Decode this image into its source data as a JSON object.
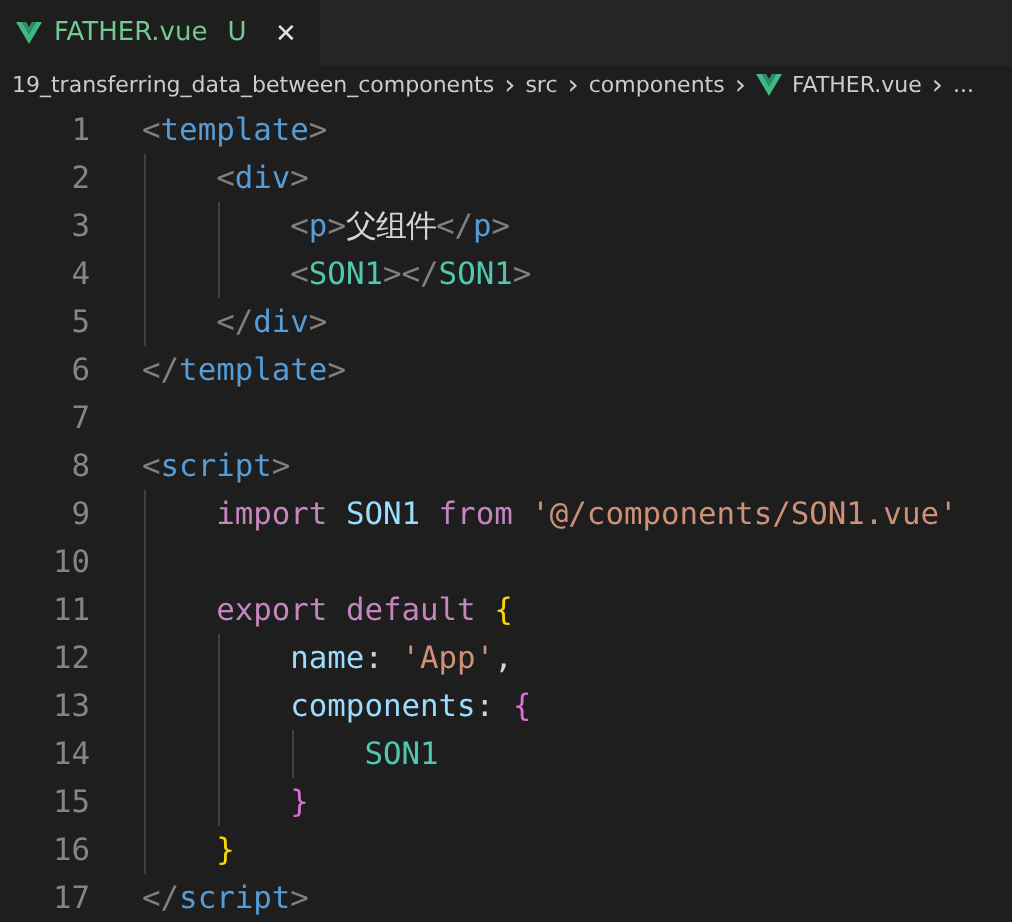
{
  "tabs": [
    {
      "label": "FATHER.vue",
      "status": "U",
      "close": "✕",
      "selected": true
    }
  ],
  "breadcrumb": [
    {
      "label": "19_transferring_data_between_components",
      "kind": "folder"
    },
    {
      "label": "src",
      "kind": "folder"
    },
    {
      "label": "components",
      "kind": "folder"
    },
    {
      "label": "FATHER.vue",
      "kind": "file"
    },
    {
      "label": "...",
      "kind": "more"
    }
  ],
  "separator": "›",
  "lines": [
    {
      "number": "1",
      "tokens": [
        {
          "text": "<",
          "color": "#808080"
        },
        {
          "text": "template",
          "color": "#569cd6"
        },
        {
          "text": ">",
          "color": "#808080"
        }
      ],
      "children": [
        {
          "number": "2",
          "tokens": [
            {
              "text": "<",
              "color": "#808080"
            },
            {
              "text": "div",
              "color": "#569cd6"
            },
            {
              "text": ">",
              "color": "#808080"
            }
          ],
          "children": [
            {
              "number": "3",
              "tokens": [
                {
                  "text": "<",
                  "color": "#808080"
                },
                {
                  "text": "p",
                  "color": "#569cd6"
                },
                {
                  "text": ">",
                  "color": "#808080"
                },
                {
                  "text": "父组件",
                  "color": "#d4d4d4"
                },
                {
                  "text": "</",
                  "color": "#808080"
                },
                {
                  "text": "p",
                  "color": "#569cd6"
                },
                {
                  "text": ">",
                  "color": "#808080"
                }
              ]
            },
            {
              "number": "4",
              "tokens": [
                {
                  "text": "<",
                  "color": "#808080"
                },
                {
                  "text": "SON1",
                  "color": "#4ec9b0"
                },
                {
                  "text": "></",
                  "color": "#808080"
                },
                {
                  "text": "SON1",
                  "color": "#4ec9b0"
                },
                {
                  "text": ">",
                  "color": "#808080"
                }
              ]
            }
          ]
        },
        {
          "number": "5",
          "tokens": [
            {
              "text": "</",
              "color": "#808080"
            },
            {
              "text": "div",
              "color": "#569cd6"
            },
            {
              "text": ">",
              "color": "#808080"
            }
          ]
        }
      ]
    },
    {
      "number": "6",
      "tokens": [
        {
          "text": "</",
          "color": "#808080"
        },
        {
          "text": "template",
          "color": "#569cd6"
        },
        {
          "text": ">",
          "color": "#808080"
        }
      ]
    },
    {
      "number": "7"
    },
    {
      "number": "8",
      "tokens": [
        {
          "text": "<",
          "color": "#808080"
        },
        {
          "text": "script",
          "color": "#569cd6"
        },
        {
          "text": ">",
          "color": "#808080"
        }
      ],
      "children": [
        {
          "number": "9",
          "tokens": [
            {
              "text": "import",
              "color": "#c586c0"
            },
            {
              "text": " SON1",
              "color": "#9cdcfe"
            },
            {
              "text": " from",
              "color": "#c586c0"
            },
            {
              "text": " '@/components/SON1.vue'",
              "color": "#ce9178"
            }
          ]
        },
        {
          "number": "10"
        },
        {
          "number": "11",
          "tokens": [
            {
              "text": "export",
              "color": "#c586c0"
            },
            {
              "text": " default",
              "color": "#c586c0"
            },
            {
              "text": " {",
              "color": "#ffd700"
            }
          ],
          "children": [
            {
              "number": "12",
              "tokens": [
                {
                  "text": "name",
                  "color": "#9cdcfe"
                },
                {
                  "text": ": ",
                  "color": "#d4d4d4"
                },
                {
                  "text": "'App'",
                  "color": "#ce9178"
                },
                {
                  "text": ",",
                  "color": "#d4d4d4"
                }
              ]
            },
            {
              "number": "13",
              "tokens": [
                {
                  "text": "components",
                  "color": "#9cdcfe"
                },
                {
                  "text": ": ",
                  "color": "#d4d4d4"
                },
                {
                  "text": "{",
                  "color": "#da70d6"
                }
              ],
              "children": [
                {
                  "number": "14",
                  "tokens": [
                    {
                      "text": "SON1",
                      "color": "#4ec9b0"
                    }
                  ]
                }
              ]
            },
            {
              "number": "15",
              "tokens": [
                {
                  "text": "}",
                  "color": "#da70d6"
                }
              ]
            }
          ]
        },
        {
          "number": "16",
          "tokens": [
            {
              "text": "}",
              "color": "#ffd700"
            }
          ]
        }
      ]
    },
    {
      "number": "17",
      "tokens": [
        {
          "text": "</",
          "color": "#808080"
        },
        {
          "text": "script",
          "color": "#569cd6"
        },
        {
          "text": ">",
          "color": "#808080"
        }
      ]
    }
  ]
}
